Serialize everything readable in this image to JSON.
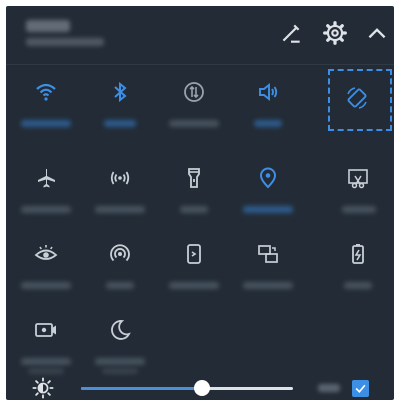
{
  "colors": {
    "panel_bg": "#232c36",
    "active": "#3d8fe6",
    "inactive_icon": "#c9cfd6",
    "highlight_border": "#3d8fe6"
  },
  "header": {
    "icons": [
      "edit-icon",
      "settings-gear-icon",
      "collapse-chevron-up-icon"
    ]
  },
  "tiles": [
    {
      "id": "wifi",
      "icon": "wifi-icon",
      "active": true
    },
    {
      "id": "bluetooth",
      "icon": "bluetooth-icon",
      "active": true
    },
    {
      "id": "mobile-data",
      "icon": "mobile-data-icon",
      "active": false
    },
    {
      "id": "sound",
      "icon": "sound-icon",
      "active": true
    },
    {
      "id": "auto-rotate",
      "icon": "auto-rotate-icon",
      "active": true,
      "highlighted": true
    },
    {
      "id": "airplane-mode",
      "icon": "airplane-icon",
      "active": false
    },
    {
      "id": "hotspot",
      "icon": "hotspot-icon",
      "active": false
    },
    {
      "id": "flashlight",
      "icon": "flashlight-icon",
      "active": false
    },
    {
      "id": "location",
      "icon": "location-pin-icon",
      "active": true
    },
    {
      "id": "screenshot",
      "icon": "screenshot-scissors-icon",
      "active": false
    },
    {
      "id": "eye-comfort",
      "icon": "eye-comfort-icon",
      "active": false
    },
    {
      "id": "nfc",
      "icon": "nfc-icon",
      "active": false
    },
    {
      "id": "multi-screen",
      "icon": "multi-screen-icon",
      "active": false
    },
    {
      "id": "screen-mirror",
      "icon": "screen-mirror-icon",
      "active": false
    },
    {
      "id": "battery-saver",
      "icon": "battery-saver-icon",
      "active": false
    },
    {
      "id": "screen-recorder",
      "icon": "screen-recorder-icon",
      "active": false
    },
    {
      "id": "do-not-disturb",
      "icon": "moon-icon",
      "active": false
    }
  ],
  "brightness": {
    "icon": "brightness-icon",
    "level": 0.57,
    "auto_enabled": true
  }
}
